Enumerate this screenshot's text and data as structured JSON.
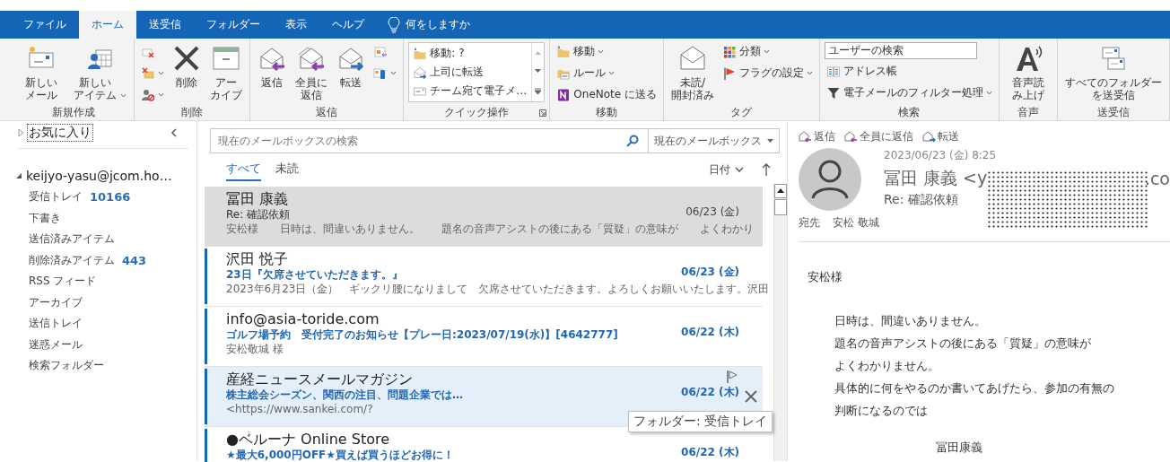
{
  "tabs": [
    {
      "label": "ファイル",
      "selected": false
    },
    {
      "label": "ホーム",
      "selected": true
    },
    {
      "label": "送受信",
      "selected": false
    },
    {
      "label": "フォルダー",
      "selected": false
    },
    {
      "label": "表示",
      "selected": false
    },
    {
      "label": "ヘルプ",
      "selected": false
    }
  ],
  "tell_me": "何をしますか",
  "ribbon": [
    {
      "name": "新規作成",
      "launcher": false,
      "items": [
        {
          "kind": "large",
          "label": "新しいメール",
          "dropdown": false
        },
        {
          "kind": "large",
          "label": "新しいアイテム",
          "dropdown": true
        }
      ]
    },
    {
      "name": "削除",
      "launcher": false,
      "items": [
        {
          "kind": "stack",
          "items": [
            {
              "kind": "button",
              "dropdown": false
            },
            {
              "kind": "button",
              "dropdown": true
            },
            {
              "kind": "button",
              "dropdown": true
            }
          ]
        },
        {
          "kind": "large",
          "label": "削除",
          "dropdown": false
        },
        {
          "kind": "large",
          "label": "アーカイブ",
          "dropdown": false
        }
      ]
    },
    {
      "name": "返信",
      "launcher": false,
      "items": [
        {
          "kind": "large",
          "label": "返信",
          "dropdown": false
        },
        {
          "kind": "large",
          "label": "全員に返信",
          "dropdown": false
        },
        {
          "kind": "large",
          "label": "転送",
          "dropdown": false
        },
        {
          "kind": "stack",
          "items": [
            {
              "kind": "button",
              "dropdown": false
            },
            {
              "kind": "button",
              "dropdown": true
            }
          ]
        }
      ]
    },
    {
      "name": "クイック操作",
      "launcher": true,
      "items": [
        {
          "kind": "gallery",
          "items": [
            "移動: ?",
            "上司に転送",
            "チーム宛て電子メ…"
          ]
        }
      ]
    },
    {
      "name": "移動",
      "launcher": false,
      "items": [
        {
          "kind": "stack",
          "items": [
            {
              "kind": "button",
              "label": "移動",
              "dropdown": true
            },
            {
              "kind": "button",
              "label": "ルール",
              "dropdown": true
            },
            {
              "kind": "button",
              "label": "OneNote に送る",
              "dropdown": false
            }
          ]
        }
      ]
    },
    {
      "name": "タグ",
      "launcher": false,
      "items": [
        {
          "kind": "large",
          "label": "未読/開封済み",
          "dropdown": false
        },
        {
          "kind": "stack",
          "items": [
            {
              "kind": "button",
              "label": "分類",
              "dropdown": true
            },
            {
              "kind": "button",
              "label": "フラグの設定",
              "dropdown": true
            }
          ]
        }
      ]
    },
    {
      "name": "検索",
      "launcher": false,
      "items": [
        {
          "kind": "stack",
          "items": [
            {
              "kind": "field",
              "value": "ユーザーの検索"
            },
            {
              "kind": "button",
              "label": "アドレス帳",
              "dropdown": false
            },
            {
              "kind": "button",
              "label": "電子メールのフィルター処理",
              "dropdown": true
            }
          ]
        }
      ]
    },
    {
      "name": "音声",
      "launcher": false,
      "items": [
        {
          "kind": "large",
          "label": "音声読み上げ",
          "dropdown": false
        }
      ]
    },
    {
      "name": "送受信",
      "launcher": false,
      "items": [
        {
          "kind": "large",
          "label": "すべてのフォルダーを送受信",
          "dropdown": false
        }
      ]
    }
  ],
  "folders": {
    "favorites": {
      "label": "お気に入り",
      "expanded": false
    },
    "account": {
      "label": "keijyo-yasu@jcom.ho…",
      "expanded": true,
      "children": [
        {
          "name": "受信トレイ",
          "count": "10166"
        },
        {
          "name": "下書き"
        },
        {
          "name": "送信済みアイテム"
        },
        {
          "name": "削除済みアイテム",
          "count": "443"
        },
        {
          "name": "RSS フィード"
        },
        {
          "name": "アーカイブ"
        },
        {
          "name": "送信トレイ"
        },
        {
          "name": "迷惑メール"
        },
        {
          "name": "検索フォルダー"
        }
      ]
    }
  },
  "mail_list": {
    "search_placeholder": "現在のメールボックスの検索",
    "scope": "現在のメールボックス",
    "filters": [
      {
        "label": "すべて",
        "selected": true
      },
      {
        "label": "未読",
        "selected": false
      }
    ],
    "sort": "日付",
    "messages": [
      {
        "sender": "冨田 康義",
        "subject": "Re: 確認依頼",
        "preview": "安松様　　日時は、間違いありません。　　題名の音声アシストの後にある「質疑」の意味が　　よくわかり",
        "date": "06/23 (金)",
        "unread": false,
        "selected": true,
        "hovered": false
      },
      {
        "sender": "沢田 悦子",
        "subject": "23日『欠席させていただきます。』",
        "preview": "2023年6月23日（金）　ギックリ腰になりまして　欠席させていただきます。よろしくお願いいたします。沢田",
        "date": "06/23 (金)",
        "unread": true,
        "selected": false,
        "hovered": false
      },
      {
        "sender": "info@asia-toride.com",
        "subject": "ゴルフ場予約　受付完了のお知らせ【プレー日:2023/07/19(水)】[4642777]",
        "preview": "安松敬城 様",
        "date": "06/22 (木)",
        "unread": true,
        "selected": false,
        "hovered": false
      },
      {
        "sender": "産経ニュースメールマガジン",
        "subject": "株主総会シーズン、関西の注目、問題企業では…",
        "preview": "<https://www.sankei.com/?",
        "date": "06/22 (木)",
        "unread": true,
        "selected": false,
        "hovered": true
      },
      {
        "sender": "●ベルーナ Online Store",
        "subject": "★最大6,000円OFF★買えば買うほどお得に！",
        "date": "06/22 (木)",
        "unread": true,
        "selected": false,
        "hovered": false
      }
    ]
  },
  "tooltip": "フォルダー: 受信トレイ",
  "reading_pane": {
    "actions": [
      "返信",
      "全員に返信",
      "転送"
    ],
    "date": "2023/06/23 (金) 8:25",
    "sender": "冨田 康義 <y",
    "sender_tail": ".co",
    "subject": "Re: 確認依頼",
    "to_label": "宛先",
    "to": "安松 敬城",
    "greeting": "安松様",
    "body": [
      "日時は、間違いありません。",
      "題名の音声アシストの後にある「質疑」の意味が",
      "よくわかりません。",
      "具体的に何をやるのか書いてあげたら、参加の有無の",
      "判断になるのでは"
    ],
    "signature": "冨田康義"
  }
}
